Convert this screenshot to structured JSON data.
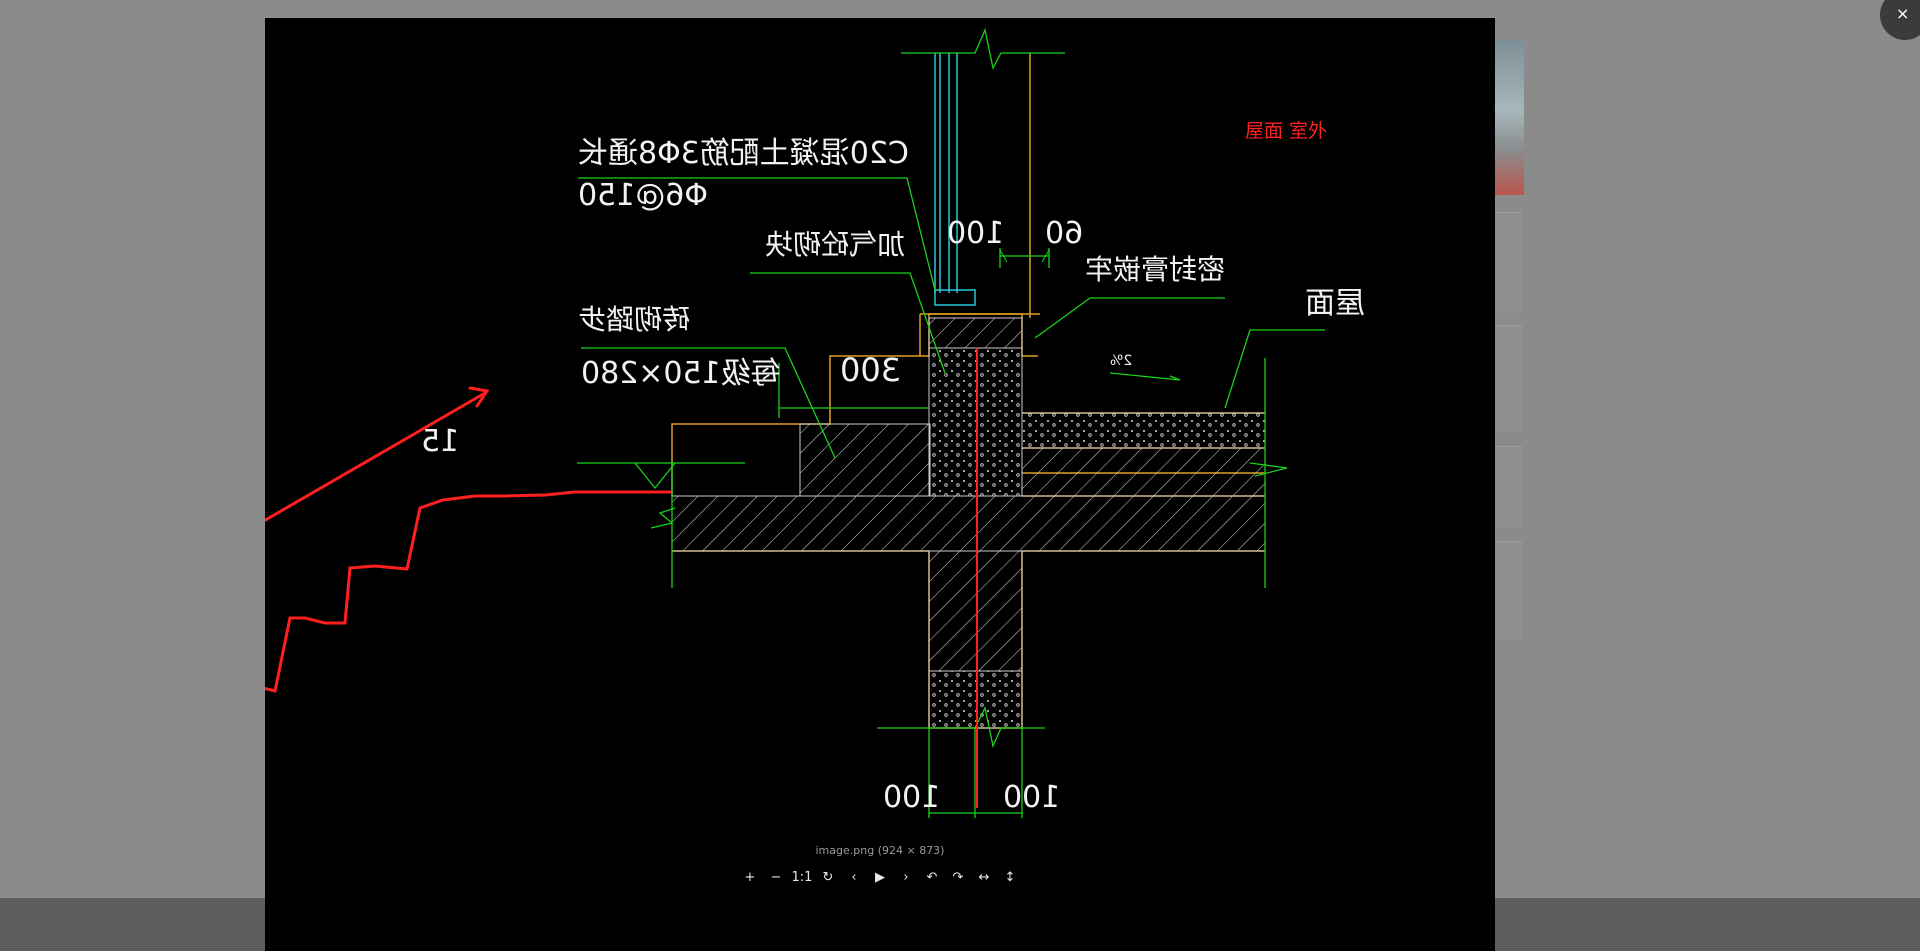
{
  "annotation": {
    "text": "屋面 室外",
    "color": "#ff2020"
  },
  "drawing_labels": {
    "c20": "C20混凝土配筋3Φ8通长",
    "phi6": "Φ6@150",
    "aerated": "加气砼砌块",
    "brick_steps": "砖砌踏步",
    "per_step": "每级150×280",
    "sealant": "密封膏嵌牢",
    "roof": "屋面",
    "dim_300": "300",
    "dim_15": "15",
    "dim_100_top": "100",
    "dim_60": "60",
    "dim_100_left": "100",
    "dim_100_right": "100",
    "slope": "2%"
  },
  "viewer": {
    "image_info": "image.png (924 × 873)",
    "toolbar": [
      "+",
      "−",
      "1:1",
      "↻",
      "‹",
      "▶",
      "›",
      "↶",
      "↷",
      "↔",
      "↕"
    ]
  },
  "close_label": "×",
  "colors": {
    "cad_background": "#000000",
    "line_green": "#19d219",
    "line_orange": "#e0a020",
    "line_cyan": "#29c9d9",
    "line_red": "#ff1f1f"
  }
}
